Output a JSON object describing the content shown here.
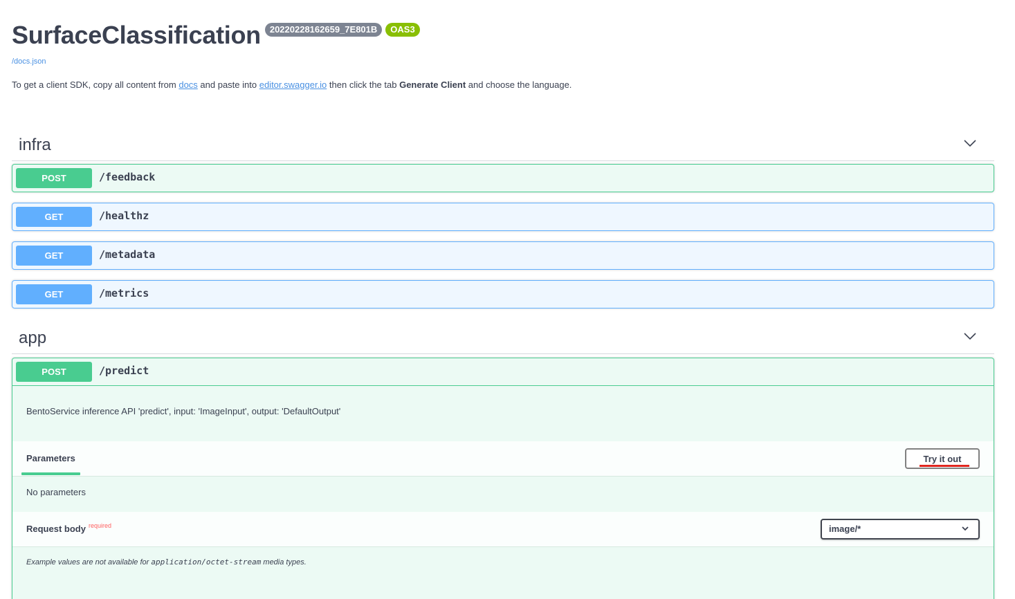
{
  "header": {
    "title": "SurfaceClassification",
    "version_badge": "20220228162659_7E801B",
    "oas_badge": "OAS3",
    "docs_link": "/docs.json"
  },
  "intro": {
    "part1": "To get a client SDK, copy all content from ",
    "docs_link": "docs",
    "part2": " and paste into ",
    "editor_link": "editor.swagger.io",
    "part3": " then click the tab ",
    "bold": "Generate Client",
    "part4": " and choose the language."
  },
  "tags": [
    {
      "name": "infra",
      "operations": [
        {
          "method": "POST",
          "path": "/feedback"
        },
        {
          "method": "GET",
          "path": "/healthz"
        },
        {
          "method": "GET",
          "path": "/metadata"
        },
        {
          "method": "GET",
          "path": "/metrics"
        }
      ]
    },
    {
      "name": "app",
      "operations": [
        {
          "method": "POST",
          "path": "/predict"
        }
      ]
    }
  ],
  "predict": {
    "description": "BentoService inference API 'predict', input: 'ImageInput', output: 'DefaultOutput'",
    "parameters_tab": "Parameters",
    "try_button": "Try it out",
    "no_parameters": "No parameters",
    "request_body_title": "Request body",
    "required_label": "required",
    "content_type": "image/*",
    "example_note_pre": "Example values are not available for ",
    "example_note_code": "application/octet-stream",
    "example_note_post": " media types."
  },
  "colors": {
    "post": "#49cc90",
    "get": "#61affe",
    "link": "#4990e2",
    "required": "#ff6060",
    "try_underline": "#e0261f"
  },
  "icons": [
    "chevron-down-icon"
  ]
}
